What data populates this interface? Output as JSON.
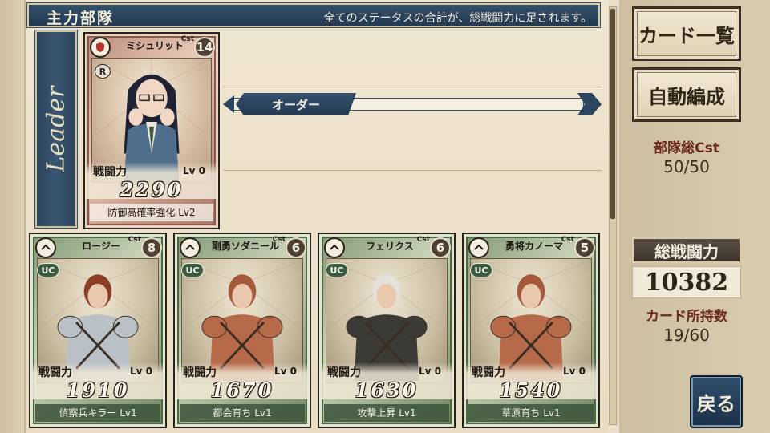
{
  "header": {
    "title": "主力部隊",
    "note": "全てのステータスの合計が、総戦闘力に足されます。"
  },
  "leader_banner": "Leader",
  "order": {
    "label": "オーダー"
  },
  "side": {
    "card_list_button": "カード一覧",
    "auto_formation_button": "自動編成",
    "team_cost_label": "部隊総Cst",
    "team_cost_value": "50/50",
    "total_power_label": "総戦闘力",
    "total_power_value": "10382",
    "cards_owned_label": "カード所持数",
    "cards_owned_value": "19/60",
    "back_button": "戻る"
  },
  "leader_card": {
    "name": "ミシュリット",
    "cost_label": "Cst",
    "cost": "14",
    "rarity": "R",
    "role_icon": "shield-icon",
    "power_label": "戦闘力",
    "level": "Lv 0",
    "power": "2290",
    "skill": "防御高確率強化 Lv2"
  },
  "cards": [
    {
      "name": "ロージー",
      "cost_label": "Cst",
      "cost": "8",
      "rarity": "UC",
      "role_icon": "chevron-up-icon",
      "power_label": "戦闘力",
      "level": "Lv 0",
      "power": "1910",
      "skill": "偵察兵キラー Lv1",
      "hair": "#8a3e22",
      "armor": "#b9c1c6"
    },
    {
      "name": "剛勇ソダニール",
      "cost_label": "Cst",
      "cost": "6",
      "rarity": "UC",
      "role_icon": "crosshair-icon",
      "power_label": "戦闘力",
      "level": "Lv 0",
      "power": "1670",
      "skill": "都会育ち Lv1",
      "hair": "#a55a3c",
      "armor": "#b66a4a"
    },
    {
      "name": "フェリクス",
      "cost_label": "Cst",
      "cost": "6",
      "rarity": "UC",
      "role_icon": "chevron-up-icon",
      "power_label": "戦闘力",
      "level": "Lv 0",
      "power": "1630",
      "skill": "攻撃上昇 Lv1",
      "hair": "#e4e1d8",
      "armor": "#3c3a36"
    },
    {
      "name": "勇将カノーマ",
      "cost_label": "Cst",
      "cost": "5",
      "rarity": "UC",
      "role_icon": "chevron-up-icon",
      "power_label": "戦闘力",
      "level": "Lv 0",
      "power": "1540",
      "skill": "草原育ち Lv1",
      "hair": "#a55a3c",
      "armor": "#b66a4a"
    }
  ]
}
